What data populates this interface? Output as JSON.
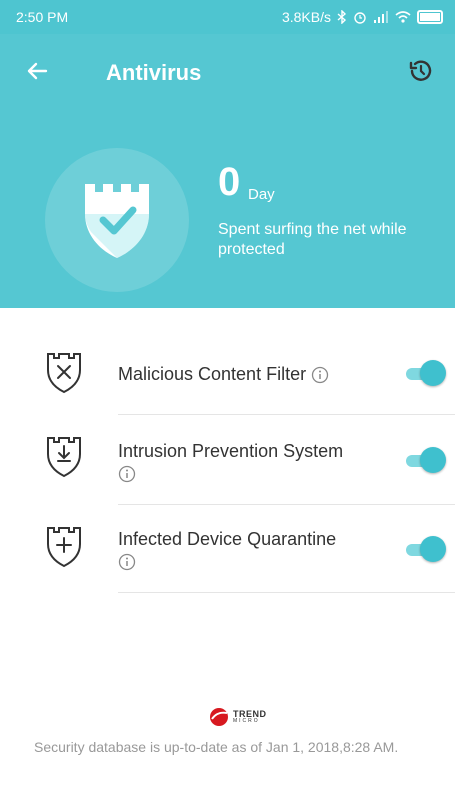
{
  "status_bar": {
    "time": "2:50 PM",
    "network_speed": "3.8KB/s",
    "icons": [
      "bluetooth-icon",
      "alarm-icon",
      "signal-icon",
      "wifi-icon",
      "battery-icon"
    ]
  },
  "header": {
    "title": "Antivirus",
    "back_icon": "arrow-left-icon",
    "history_icon": "history-icon",
    "days_count": "0",
    "days_unit": "Day",
    "description": "Spent surfing the net while protected",
    "background_color": "#55c7d2"
  },
  "features": [
    {
      "label": "Malicious Content Filter",
      "icon": "shield-x-icon",
      "enabled": true
    },
    {
      "label": "Intrusion Prevention System",
      "icon": "shield-download-icon",
      "enabled": true
    },
    {
      "label": "Infected Device Quarantine",
      "icon": "shield-plus-icon",
      "enabled": true
    }
  ],
  "footer": {
    "brand_name": "TREND",
    "brand_sub": "MICRO",
    "database_status": "Security database is up-to-date as of Jan 1, 2018,8:28 AM."
  }
}
